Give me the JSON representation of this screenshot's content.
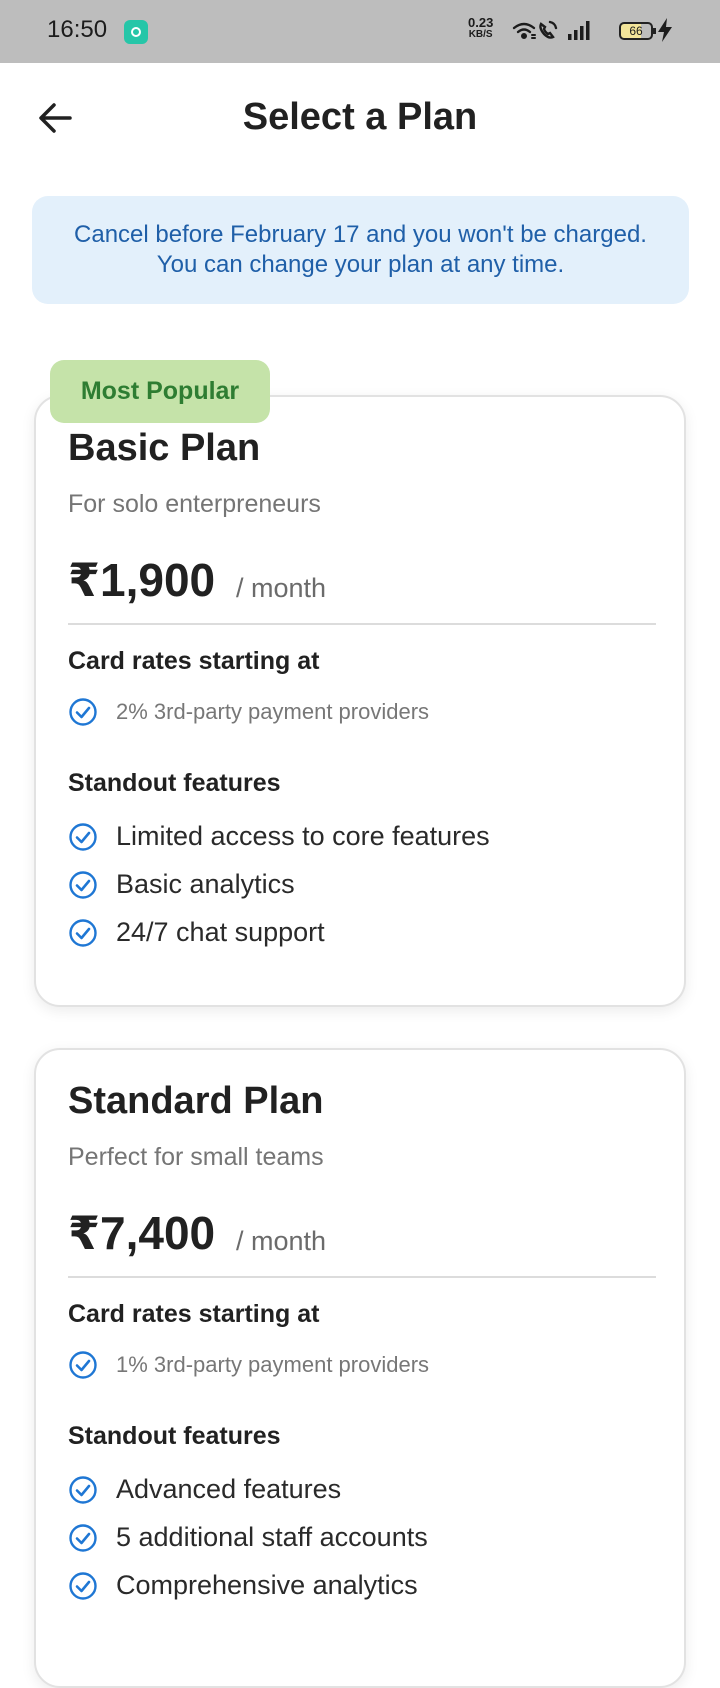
{
  "status_bar": {
    "time": "16:50",
    "net_speed": "0.23",
    "net_unit": "KB/S",
    "battery": "66",
    "icons": [
      "app-icon",
      "wifi-icon",
      "call-icon",
      "signal-icon",
      "battery-icon",
      "charging-icon"
    ]
  },
  "header": {
    "title": "Select a Plan",
    "back_icon": "arrow-left-icon"
  },
  "notice": {
    "text": "Cancel before February 17 and you won't be charged. You can change your plan at any time."
  },
  "plans": [
    {
      "badge": "Most Popular",
      "name": "Basic Plan",
      "description": "For solo enterpreneurs",
      "price": "₹1,900",
      "period": "/ month",
      "rates_title": "Card rates starting at",
      "rate": "2% 3rd-party payment providers",
      "features_title": "Standout features",
      "features": [
        "Limited access to core features",
        "Basic analytics",
        "24/7 chat support"
      ]
    },
    {
      "name": "Standard Plan",
      "description": "Perfect for small teams",
      "price": "₹7,400",
      "period": "/ month",
      "rates_title": "Card rates starting at",
      "rate": "1% 3rd-party payment providers",
      "features_title": "Standout features",
      "features": [
        "Advanced features",
        "5 additional staff accounts",
        "Comprehensive analytics"
      ]
    }
  ],
  "colors": {
    "accent_blue": "#1f77d4",
    "notice_bg": "#e3f0fb",
    "notice_text": "#1f5fa8",
    "badge_bg": "#c5e3a9",
    "badge_text": "#2e7d32"
  }
}
